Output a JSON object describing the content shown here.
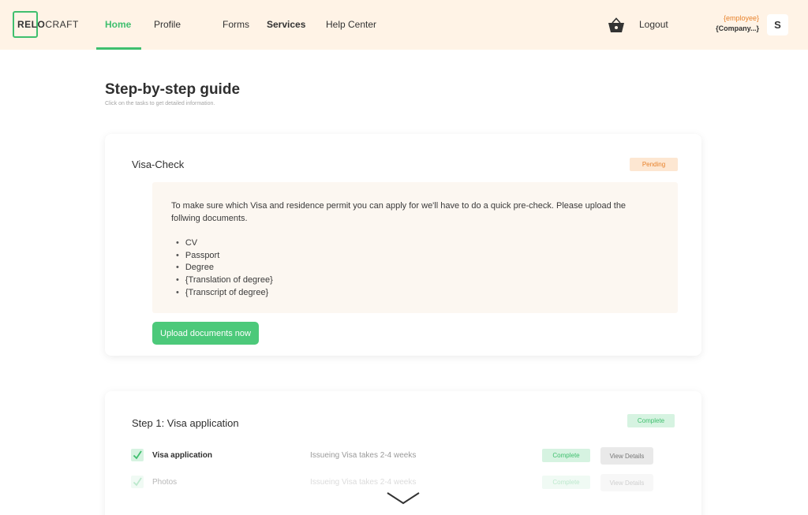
{
  "header": {
    "logo": {
      "text_bold": "RELO",
      "text_light": "CRAFT"
    },
    "nav": [
      {
        "label": "Home",
        "active": true
      },
      {
        "label": "Profile"
      },
      {
        "label": "Forms"
      },
      {
        "label": "Services"
      },
      {
        "label": "Help Center"
      }
    ],
    "cart_icon": "basket-icon",
    "logout_label": "Logout",
    "user": {
      "role": "{employee}",
      "company": "{Company...}",
      "avatar_initial": "S"
    }
  },
  "page": {
    "title": "Step-by-step guide",
    "subtitle": "Click on the tasks to get detailed information."
  },
  "visa_check": {
    "title": "Visa-Check",
    "status": "Pending",
    "description": "To make sure which Visa and residence permit you can apply for we'll have to do a quick pre-check. Please upload the follwing documents.",
    "documents": [
      "CV",
      "Passport",
      "Degree",
      "{Translation of degree}",
      "{Transcript of degree}"
    ],
    "upload_button": "Upload documents now"
  },
  "step1": {
    "title": "Step 1: Visa application",
    "status": "Complete",
    "tasks": [
      {
        "name": "Visa application",
        "note": "Issueing Visa takes 2-4 weeks",
        "status": "Complete",
        "action": "View Details"
      },
      {
        "name": "Photos",
        "note": "Issueing Visa takes 2-4 weeks",
        "status": "Complete",
        "action": "View Details"
      }
    ]
  },
  "colors": {
    "accent": "#3fbf6e",
    "header_bg": "#fff3e6",
    "pending": "#e8822c",
    "info_bg": "#fcf7f1"
  }
}
